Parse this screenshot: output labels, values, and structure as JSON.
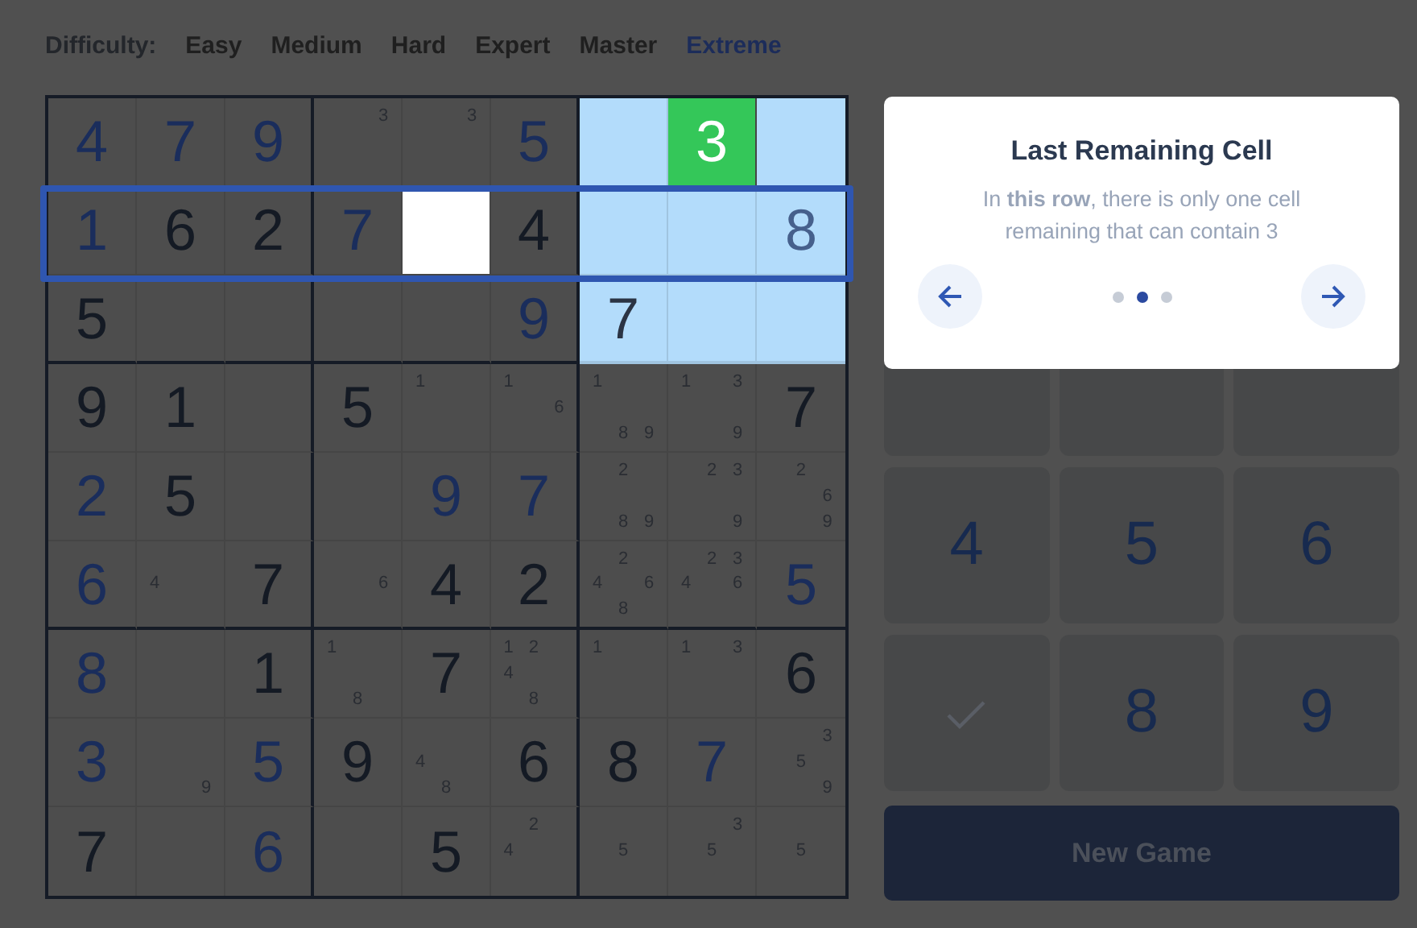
{
  "difficulty": {
    "label": "Difficulty:",
    "options": [
      {
        "label": "Easy",
        "selected": false
      },
      {
        "label": "Medium",
        "selected": false
      },
      {
        "label": "Hard",
        "selected": false
      },
      {
        "label": "Expert",
        "selected": false
      },
      {
        "label": "Master",
        "selected": false
      },
      {
        "label": "Extreme",
        "selected": true
      }
    ]
  },
  "grid": {
    "rows": [
      {
        "framed": false,
        "cells": [
          {
            "value": "4",
            "entered": true,
            "kind": "dimmed"
          },
          {
            "value": "7",
            "entered": true,
            "kind": "dimmed"
          },
          {
            "value": "9",
            "entered": true,
            "kind": "dimmed"
          },
          {
            "notes": [
              "3"
            ],
            "kind": "dimmed"
          },
          {
            "notes": [
              "3"
            ],
            "kind": "dimmed"
          },
          {
            "value": "5",
            "entered": true,
            "kind": "dimmed"
          },
          {
            "kind": "highlighted"
          },
          {
            "value": "3",
            "entered": true,
            "kind": "answer"
          },
          {
            "kind": "highlighted"
          }
        ]
      },
      {
        "framed": true,
        "cells": [
          {
            "value": "1",
            "entered": true,
            "kind": "dimmed"
          },
          {
            "value": "6",
            "entered": false,
            "kind": "dimmed"
          },
          {
            "value": "2",
            "entered": false,
            "kind": "dimmed"
          },
          {
            "value": "7",
            "entered": true,
            "kind": "dimmed"
          },
          {
            "kind": "target"
          },
          {
            "value": "4",
            "entered": false,
            "kind": "dimmed"
          },
          {
            "kind": "highlighted"
          },
          {
            "kind": "highlighted"
          },
          {
            "value": "8",
            "entered": true,
            "kind": "highlighted"
          }
        ]
      },
      {
        "framed": false,
        "cells": [
          {
            "value": "5",
            "entered": false,
            "kind": "dimmed"
          },
          {
            "kind": "dimmed"
          },
          {
            "kind": "dimmed"
          },
          {
            "kind": "dimmed"
          },
          {
            "kind": "dimmed"
          },
          {
            "value": "9",
            "entered": true,
            "kind": "dimmed"
          },
          {
            "value": "7",
            "entered": false,
            "kind": "highlighted"
          },
          {
            "kind": "highlighted"
          },
          {
            "kind": "highlighted"
          }
        ]
      },
      {
        "framed": false,
        "cells": [
          {
            "value": "9",
            "entered": false,
            "kind": "dimmed"
          },
          {
            "value": "1",
            "entered": false,
            "kind": "dimmed"
          },
          {
            "kind": "dimmed"
          },
          {
            "value": "5",
            "entered": false,
            "kind": "dimmed"
          },
          {
            "notes": [
              "1"
            ],
            "kind": "dimmed"
          },
          {
            "notes": [
              "1",
              "6"
            ],
            "kind": "dimmed"
          },
          {
            "notes": [
              "1",
              "8",
              "9"
            ],
            "kind": "dimmed"
          },
          {
            "notes": [
              "1",
              "3",
              "9"
            ],
            "kind": "dimmed"
          },
          {
            "value": "7",
            "entered": false,
            "kind": "dimmed"
          }
        ]
      },
      {
        "framed": false,
        "cells": [
          {
            "value": "2",
            "entered": true,
            "kind": "dimmed"
          },
          {
            "value": "5",
            "entered": false,
            "kind": "dimmed"
          },
          {
            "kind": "dimmed"
          },
          {
            "kind": "dimmed"
          },
          {
            "value": "9",
            "entered": true,
            "kind": "dimmed"
          },
          {
            "value": "7",
            "entered": true,
            "kind": "dimmed"
          },
          {
            "notes": [
              "2",
              "8",
              "9"
            ],
            "kind": "dimmed"
          },
          {
            "notes": [
              "2",
              "3",
              "9"
            ],
            "kind": "dimmed"
          },
          {
            "notes": [
              "2",
              "6",
              "9"
            ],
            "kind": "dimmed"
          }
        ]
      },
      {
        "framed": false,
        "cells": [
          {
            "value": "6",
            "entered": true,
            "kind": "dimmed"
          },
          {
            "notes": [
              "4"
            ],
            "kind": "dimmed"
          },
          {
            "value": "7",
            "entered": false,
            "kind": "dimmed"
          },
          {
            "notes": [
              "6"
            ],
            "kind": "dimmed"
          },
          {
            "value": "4",
            "entered": false,
            "kind": "dimmed"
          },
          {
            "value": "2",
            "entered": false,
            "kind": "dimmed"
          },
          {
            "notes": [
              "2",
              "4",
              "6",
              "8"
            ],
            "kind": "dimmed"
          },
          {
            "notes": [
              "2",
              "3",
              "4",
              "6"
            ],
            "kind": "dimmed"
          },
          {
            "value": "5",
            "entered": true,
            "kind": "dimmed"
          }
        ]
      },
      {
        "framed": false,
        "cells": [
          {
            "value": "8",
            "entered": true,
            "kind": "dimmed"
          },
          {
            "kind": "dimmed"
          },
          {
            "value": "1",
            "entered": false,
            "kind": "dimmed"
          },
          {
            "notes": [
              "1",
              "8"
            ],
            "kind": "dimmed"
          },
          {
            "value": "7",
            "entered": false,
            "kind": "dimmed"
          },
          {
            "notes": [
              "1",
              "2",
              "4",
              "8"
            ],
            "kind": "dimmed"
          },
          {
            "notes": [
              "1"
            ],
            "kind": "dimmed"
          },
          {
            "notes": [
              "1",
              "3"
            ],
            "kind": "dimmed"
          },
          {
            "value": "6",
            "entered": false,
            "kind": "dimmed"
          }
        ]
      },
      {
        "framed": false,
        "cells": [
          {
            "value": "3",
            "entered": true,
            "kind": "dimmed"
          },
          {
            "notes": [
              "9"
            ],
            "kind": "dimmed"
          },
          {
            "value": "5",
            "entered": true,
            "kind": "dimmed"
          },
          {
            "value": "9",
            "entered": false,
            "kind": "dimmed"
          },
          {
            "notes": [
              "4",
              "8"
            ],
            "kind": "dimmed"
          },
          {
            "value": "6",
            "entered": false,
            "kind": "dimmed"
          },
          {
            "value": "8",
            "entered": false,
            "kind": "dimmed"
          },
          {
            "value": "7",
            "entered": true,
            "kind": "dimmed"
          },
          {
            "notes": [
              "3",
              "5",
              "9"
            ],
            "kind": "dimmed"
          }
        ]
      },
      {
        "framed": false,
        "cells": [
          {
            "value": "7",
            "entered": false,
            "kind": "dimmed"
          },
          {
            "kind": "dimmed"
          },
          {
            "value": "6",
            "entered": true,
            "kind": "dimmed"
          },
          {
            "kind": "dimmed"
          },
          {
            "value": "5",
            "entered": false,
            "kind": "dimmed"
          },
          {
            "notes": [
              "2",
              "4"
            ],
            "kind": "dimmed"
          },
          {
            "notes": [
              "5"
            ],
            "kind": "dimmed"
          },
          {
            "notes": [
              "3",
              "5"
            ],
            "kind": "dimmed"
          },
          {
            "notes": [
              "5"
            ],
            "kind": "dimmed"
          }
        ]
      }
    ]
  },
  "hint": {
    "title": "Last Remaining Cell",
    "text": "In **this row**, there is only one cell remaining that can contain 3",
    "pages": [
      {
        "selected": false
      },
      {
        "selected": true
      },
      {
        "selected": false
      }
    ]
  },
  "keypad": [
    {
      "kind": "covered"
    },
    {
      "kind": "covered"
    },
    {
      "kind": "covered"
    },
    {
      "kind": "digit",
      "label": "4"
    },
    {
      "kind": "digit",
      "label": "5"
    },
    {
      "kind": "digit",
      "label": "6"
    },
    {
      "kind": "check"
    },
    {
      "kind": "digit",
      "label": "8"
    },
    {
      "kind": "digit",
      "label": "9"
    }
  ],
  "new_game": "New Game"
}
